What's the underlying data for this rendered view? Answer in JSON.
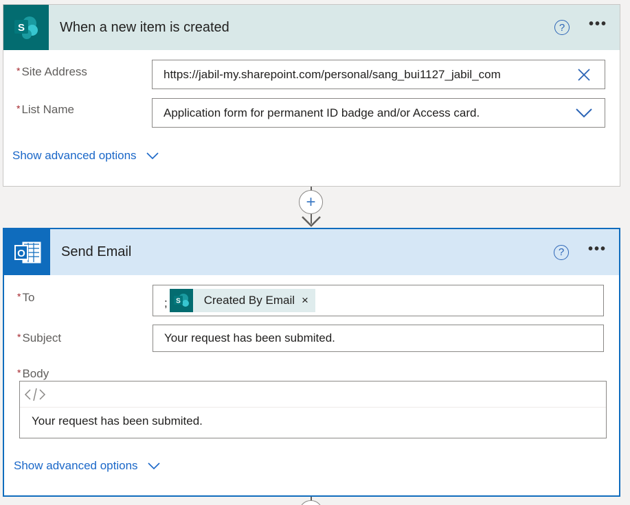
{
  "trigger": {
    "title": "When a new item is created",
    "help_glyph": "?",
    "more_glyph": "•••",
    "icon_letter": "S",
    "fields": {
      "site_address": {
        "label": "Site Address",
        "value": "https://jabil-my.sharepoint.com/personal/sang_bui1127_jabil_com",
        "trailing_icon": "close-icon"
      },
      "list_name": {
        "label": "List Name",
        "value": "Application form for permanent ID badge and/or Access card.",
        "trailing_icon": "chevron-down-icon"
      }
    },
    "advanced_label": "Show advanced options"
  },
  "connector": {
    "add_glyph": "+"
  },
  "action": {
    "title": "Send Email",
    "help_glyph": "?",
    "more_glyph": "•••",
    "icon_letter": "O",
    "fields": {
      "to": {
        "label": "To",
        "prefix": ";",
        "token_label": "Created By Email",
        "token_icon_letter": "S",
        "token_remove": "×"
      },
      "subject": {
        "label": "Subject",
        "value": "Your request has been submited."
      },
      "body": {
        "label": "Body",
        "value": "Your request has been submited.",
        "toolbar_icon": "code-view-icon"
      }
    },
    "advanced_label": "Show advanced options"
  },
  "required_marker": "*",
  "colors": {
    "sharepoint_brand": "#036c70",
    "outlook_brand": "#0f6cbd",
    "link": "#1a67c8",
    "required": "#a4262c"
  }
}
